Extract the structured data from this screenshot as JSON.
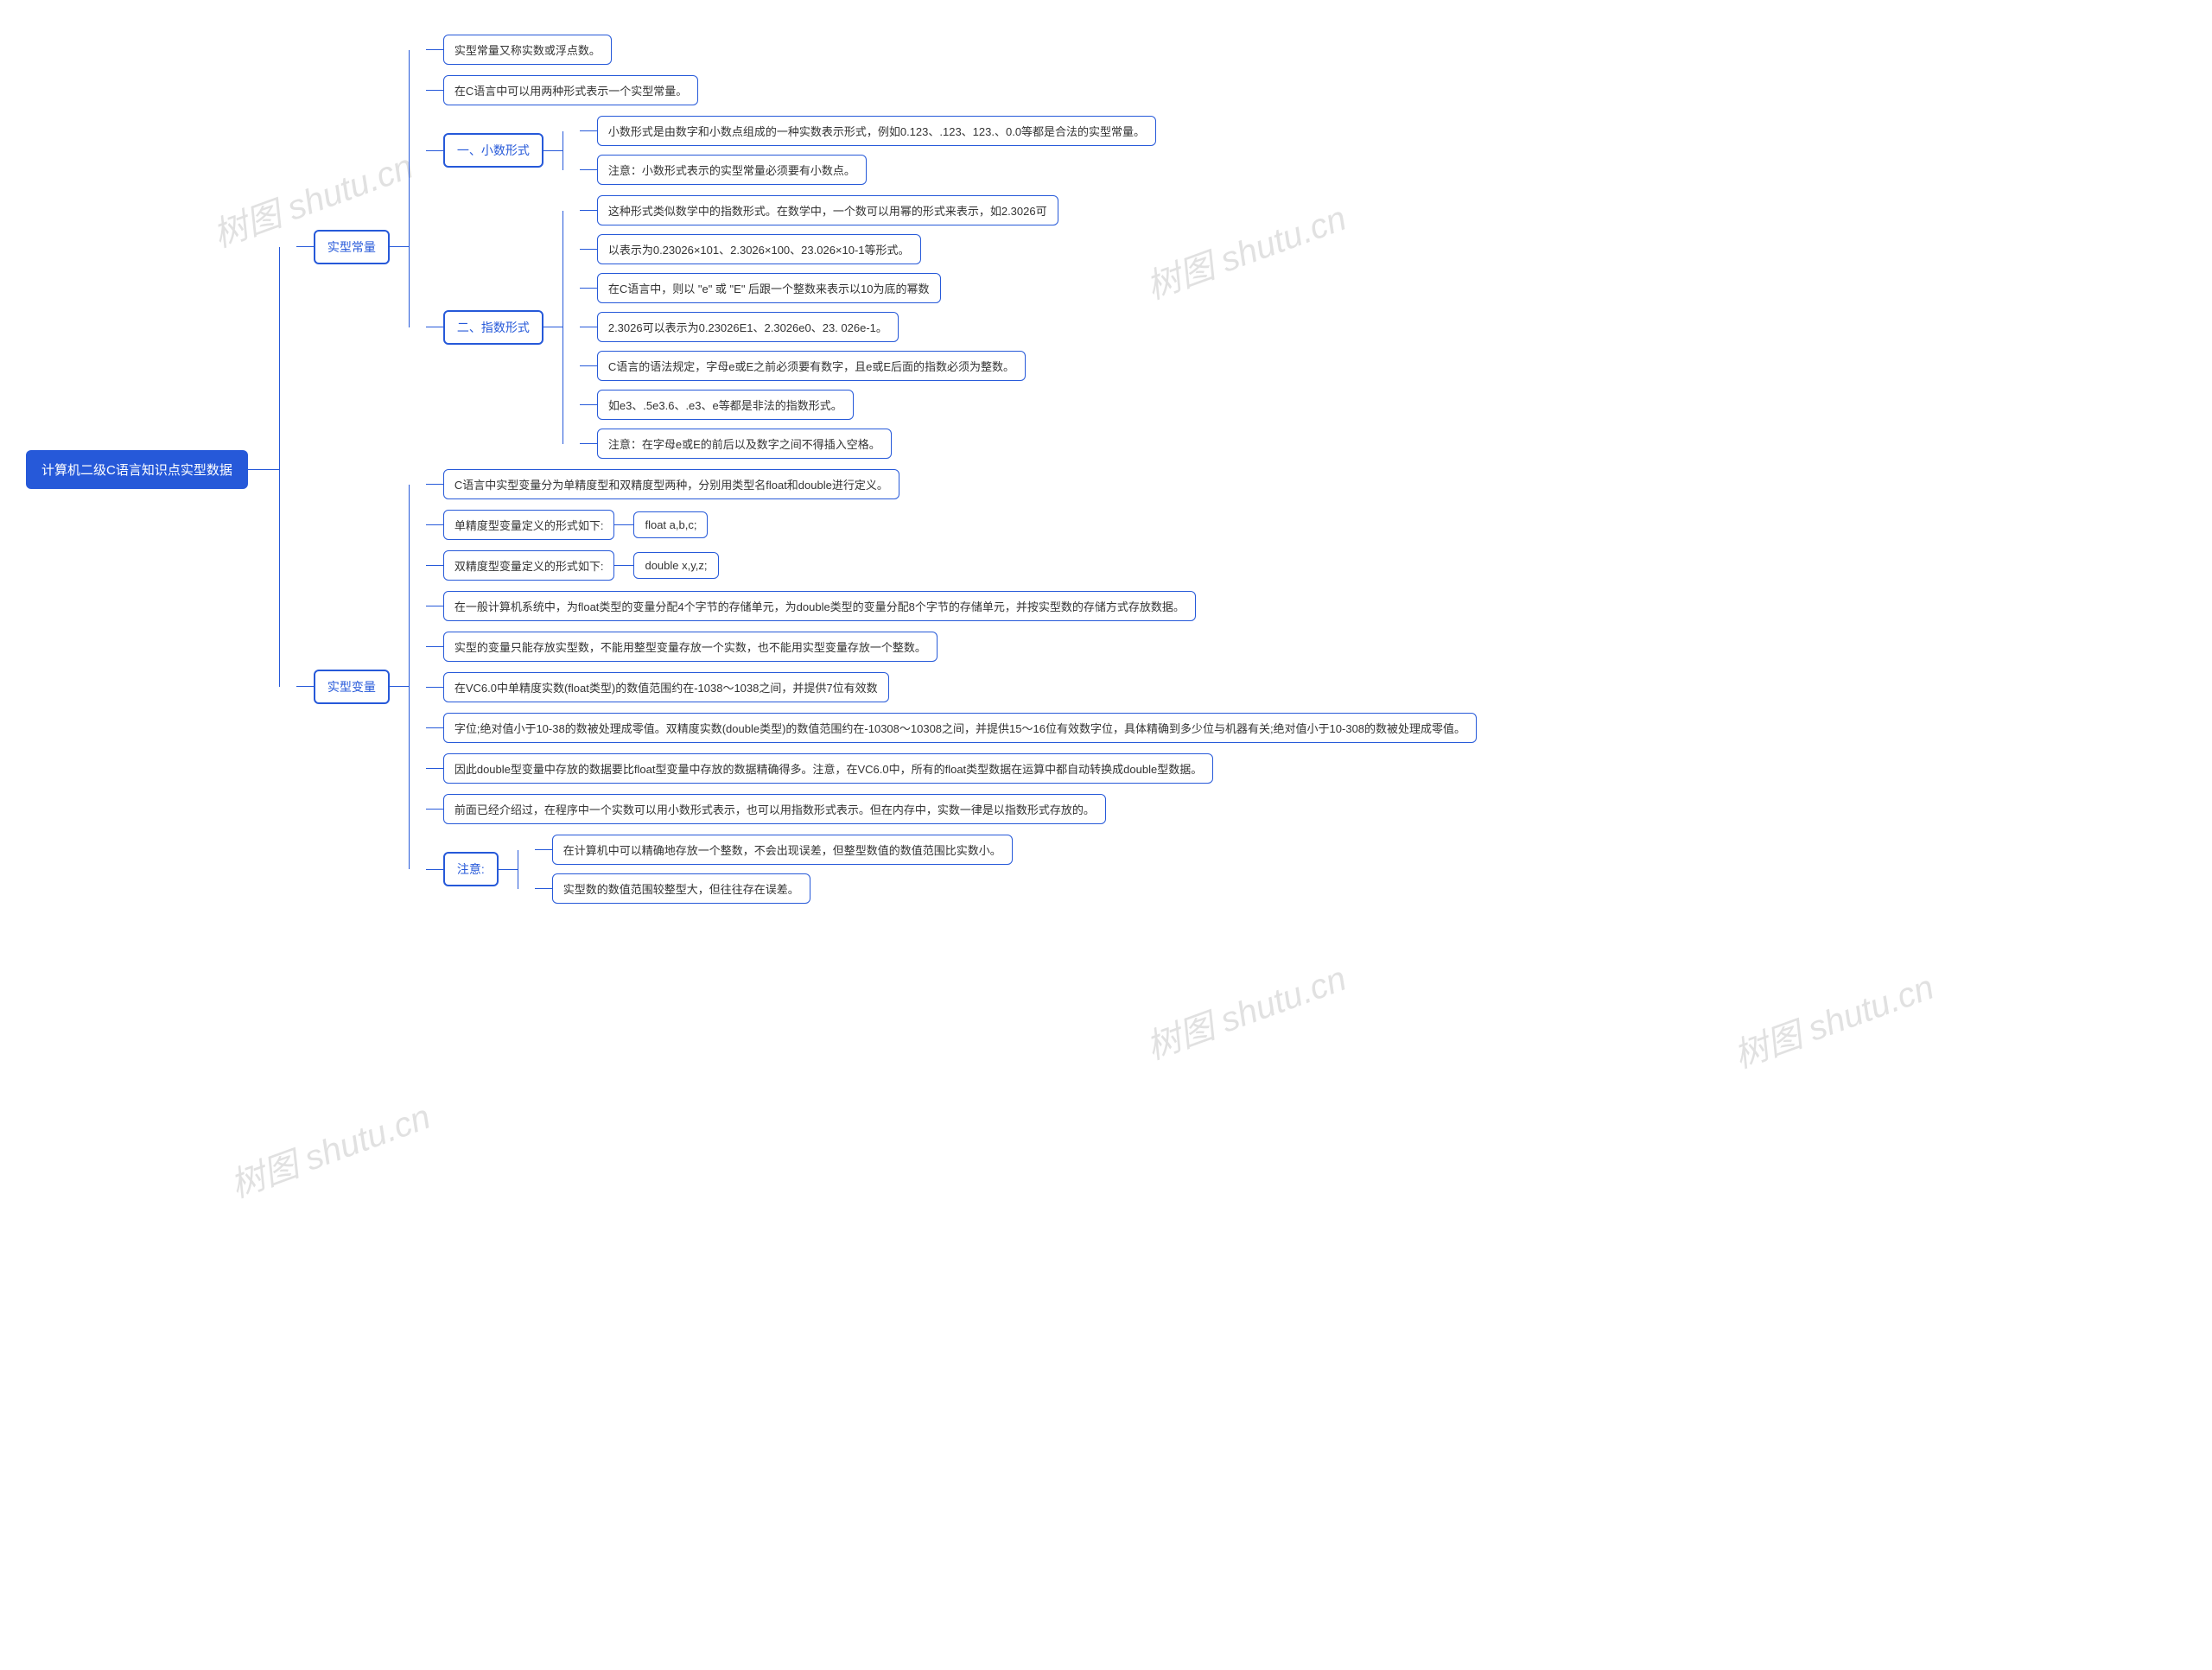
{
  "watermark": "树图 shutu.cn",
  "root": "计算机二级C语言知识点实型数据",
  "branches": {
    "const": {
      "label": "实型常量",
      "leaves": [
        "实型常量又称实数或浮点数。",
        "在C语言中可以用两种形式表示一个实型常量。"
      ],
      "decimal": {
        "label": "一、小数形式",
        "leaves": [
          "小数形式是由数字和小数点组成的一种实数表示形式，例如0.123、.123、123.、0.0等都是合法的实型常量。",
          "注意：小数形式表示的实型常量必须要有小数点。"
        ]
      },
      "exp": {
        "label": "二、指数形式",
        "leaves": [
          "这种形式类似数学中的指数形式。在数学中，一个数可以用幂的形式来表示，如2.3026可",
          "以表示为0.23026×101、2.3026×100、23.026×10-1等形式。",
          "在C语言中，则以 \"e\" 或 \"E\" 后跟一个整数来表示以10为底的幂数",
          "2.3026可以表示为0.23026E1、2.3026e0、23. 026e-1。",
          "C语言的语法规定，字母e或E之前必须要有数字，且e或E后面的指数必须为整数。",
          "如e3、.5e3.6、.e3、e等都是非法的指数形式。",
          "注意：在字母e或E的前后以及数字之间不得插入空格。"
        ]
      }
    },
    "var": {
      "label": "实型变量",
      "leaves_top": [
        "C语言中实型变量分为单精度型和双精度型两种，分别用类型名float和double进行定义。"
      ],
      "single": {
        "label": "单精度型变量定义的形式如下:",
        "value": "float a,b,c;"
      },
      "double": {
        "label": "双精度型变量定义的形式如下:",
        "value": "double x,y,z;"
      },
      "leaves_mid": [
        "在一般计算机系统中，为float类型的变量分配4个字节的存储单元，为double类型的变量分配8个字节的存储单元，并按实型数的存储方式存放数据。",
        "实型的变量只能存放实型数，不能用整型变量存放一个实数，也不能用实型变量存放一个整数。",
        "在VC6.0中单精度实数(float类型)的数值范围约在-1038～1038之间，并提供7位有效数",
        "字位;绝对值小于10-38的数被处理成零值。双精度实数(double类型)的数值范围约在-10308～10308之间，并提供15～16位有效数字位，具体精确到多少位与机器有关;绝对值小于10-308的数被处理成零值。",
        "因此double型变量中存放的数据要比float型变量中存放的数据精确得多。注意，在VC6.0中，所有的float类型数据在运算中都自动转换成double型数据。",
        "前面已经介绍过，在程序中一个实数可以用小数形式表示，也可以用指数形式表示。但在内存中，实数一律是以指数形式存放的。"
      ],
      "note": {
        "label": "注意:",
        "leaves": [
          "在计算机中可以精确地存放一个整数，不会出现误差，但整型数值的数值范围比实数小。",
          "实型数的数值范围较整型大，但往往存在误差。"
        ]
      }
    }
  }
}
